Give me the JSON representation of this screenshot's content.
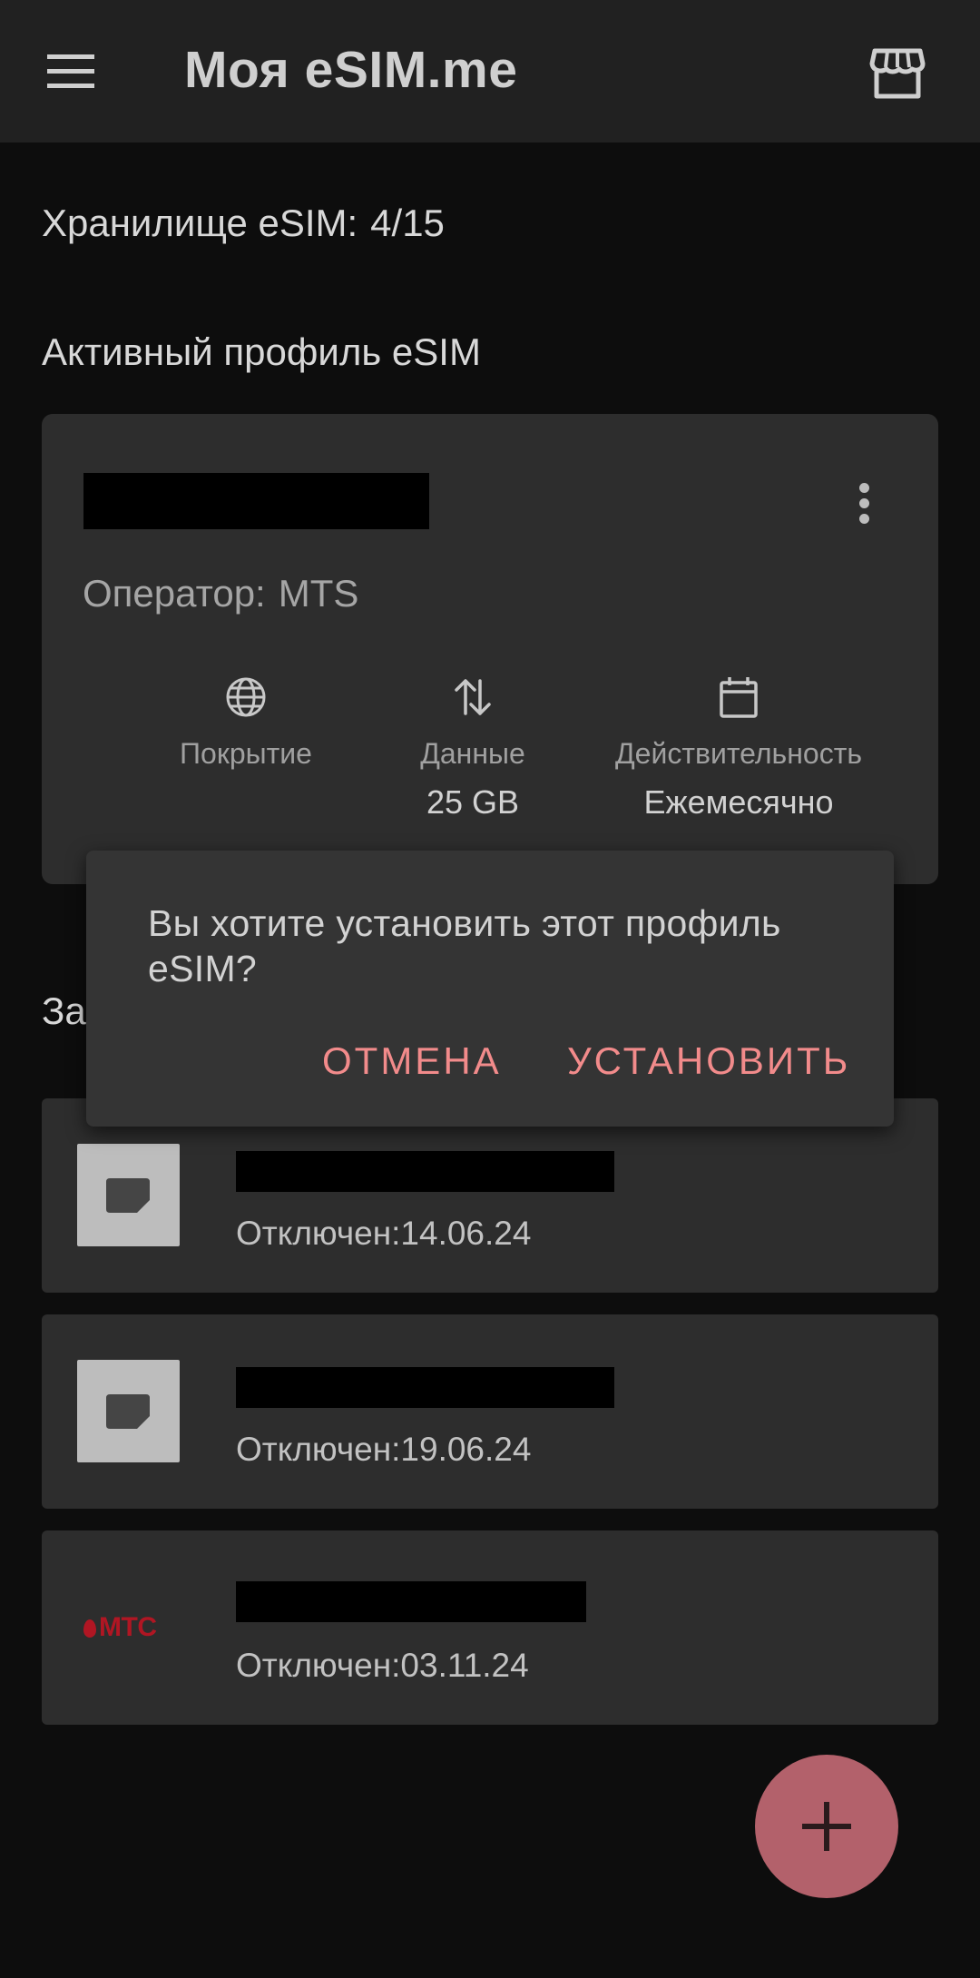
{
  "app_bar": {
    "title": "Моя eSIM.me",
    "menu_icon": "hamburger-menu-icon",
    "store_icon": "storefront-icon"
  },
  "storage": {
    "label": "Хранилище eSIM:",
    "value": "4/15"
  },
  "active_section": {
    "heading": "Активный профиль eSIM",
    "card": {
      "operator_label": "Оператор:",
      "operator_value": "MTS",
      "stats": [
        {
          "icon": "globe-icon",
          "label": "Покрытие",
          "value": ""
        },
        {
          "icon": "arrows-up-down-icon",
          "label": "Данные",
          "value": "25 GB"
        },
        {
          "icon": "calendar-icon",
          "label": "Действительность",
          "value": "Ежемесячно"
        }
      ]
    }
  },
  "saved_section": {
    "heading_visible": "За"
  },
  "profiles": [
    {
      "logo": "sim-card-icon",
      "status": "Отключен:14.06.24"
    },
    {
      "logo": "sim-card-icon",
      "status": "Отключен:19.06.24"
    },
    {
      "logo": "mts-logo",
      "logo_text": "МТС",
      "status": "Отключен:03.11.24"
    }
  ],
  "fab": {
    "icon": "plus-icon"
  },
  "dialog": {
    "message": "Вы хотите установить этот профиль eSIM?",
    "cancel_label": "ОТМЕНА",
    "confirm_label": "УСТАНОВИТЬ"
  },
  "colors": {
    "background": "#0d0d0d",
    "app_bar": "#212121",
    "card": "#2d2d2d",
    "dialog": "#343434",
    "accent": "#f28b8b",
    "fab": "#b3616b",
    "mts_red": "#b01623"
  }
}
